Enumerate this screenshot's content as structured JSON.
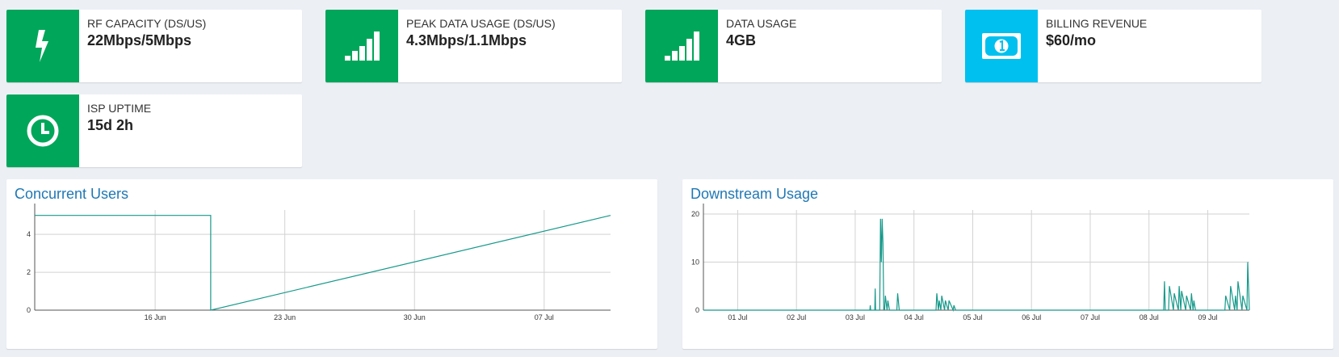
{
  "colors": {
    "green": "#00a65a",
    "aqua": "#00c0ef",
    "line": "#16998a",
    "title": "#1f78b4",
    "grid": "#d2d2d2"
  },
  "info_boxes": [
    {
      "label": "RF CAPACITY (DS/US)",
      "value": "22Mbps/5Mbps",
      "icon": "bolt-icon"
    },
    {
      "label": "PEAK DATA USAGE (DS/US)",
      "value": "4.3Mbps/1.1Mbps",
      "icon": "signal-bars-icon"
    },
    {
      "label": "DATA USAGE",
      "value": "4GB",
      "icon": "signal-bars-icon"
    },
    {
      "label": "BILLING REVENUE",
      "value": "$60/mo",
      "icon": "money-bill-icon"
    },
    {
      "label": "ISP UPTIME",
      "value": "15d 2h",
      "icon": "clock-icon"
    }
  ],
  "panels": {
    "concurrent": {
      "title": "Concurrent Users"
    },
    "downstream": {
      "title": "Downstream Usage"
    }
  },
  "chart_data": [
    {
      "type": "line",
      "title": "Concurrent Users",
      "xlabel": "",
      "ylabel": "",
      "x_ticks": [
        "16 Jun",
        "23 Jun",
        "30 Jun",
        "07 Jul"
      ],
      "x_range": [
        "2023-06-09T12:00",
        "2023-07-10T14:00"
      ],
      "ylim": [
        0,
        5.2
      ],
      "y_ticks": [
        0,
        2,
        4
      ],
      "grid": true,
      "series": [
        {
          "x": [
            "2023-06-09T12:00",
            "2023-06-19T00:00",
            "2023-06-19T00:00",
            "2023-07-10T14:00"
          ],
          "values": [
            5,
            5,
            0,
            5
          ]
        }
      ]
    },
    {
      "type": "line",
      "title": "Downstream Usage",
      "xlabel": "",
      "ylabel": "",
      "x_ticks": [
        "01 Jul",
        "02 Jul",
        "03 Jul",
        "04 Jul",
        "05 Jul",
        "06 Jul",
        "07 Jul",
        "08 Jul",
        "09 Jul"
      ],
      "x_range": [
        "2023-06-30T10:00",
        "2023-07-09T17:00"
      ],
      "ylim": [
        0,
        20.5
      ],
      "y_ticks": [
        0,
        10,
        20
      ],
      "grid": true,
      "series": [
        {
          "x": [
            "2023-06-30T10:00",
            "2023-07-03T06:00",
            "2023-07-03T06:10",
            "2023-07-03T06:20",
            "2023-07-03T08:00",
            "2023-07-03T08:10",
            "2023-07-03T08:20",
            "2023-07-03T10:00",
            "2023-07-03T10:20",
            "2023-07-03T10:40",
            "2023-07-03T11:00",
            "2023-07-03T11:20",
            "2023-07-03T11:40",
            "2023-07-03T12:00",
            "2023-07-03T12:20",
            "2023-07-03T13:00",
            "2023-07-03T13:20",
            "2023-07-03T14:00",
            "2023-07-03T14:20",
            "2023-07-03T17:00",
            "2023-07-03T17:20",
            "2023-07-03T18:00",
            "2023-07-04T09:00",
            "2023-07-04T09:20",
            "2023-07-04T10:00",
            "2023-07-04T10:20",
            "2023-07-04T11:00",
            "2023-07-04T11:20",
            "2023-07-04T12:30",
            "2023-07-04T12:50",
            "2023-07-04T14:00",
            "2023-07-04T14:20",
            "2023-07-04T16:00",
            "2023-07-04T16:20",
            "2023-07-04T17:00",
            "2023-07-08T06:00",
            "2023-07-08T06:20",
            "2023-07-08T06:40",
            "2023-07-08T08:00",
            "2023-07-08T08:20",
            "2023-07-08T10:00",
            "2023-07-08T10:20",
            "2023-07-08T12:00",
            "2023-07-08T12:20",
            "2023-07-08T13:00",
            "2023-07-08T13:20",
            "2023-07-08T15:00",
            "2023-07-08T15:20",
            "2023-07-08T17:00",
            "2023-07-08T17:20",
            "2023-07-08T18:00",
            "2023-07-08T18:20",
            "2023-07-08T19:00",
            "2023-07-09T07:00",
            "2023-07-09T07:20",
            "2023-07-09T09:00",
            "2023-07-09T09:20",
            "2023-07-09T11:00",
            "2023-07-09T11:20",
            "2023-07-09T12:00",
            "2023-07-09T12:20",
            "2023-07-09T14:00",
            "2023-07-09T14:20",
            "2023-07-09T16:00",
            "2023-07-09T16:20",
            "2023-07-09T17:00"
          ],
          "values": [
            0,
            0,
            1,
            0,
            0,
            4.5,
            0,
            0,
            19,
            10,
            19,
            14,
            0,
            0,
            3,
            0,
            2,
            0,
            0,
            0,
            3.5,
            0,
            0,
            3.5,
            0,
            2,
            0,
            3,
            0,
            2,
            0,
            2,
            0,
            1,
            0,
            0,
            6,
            0,
            0,
            5,
            0,
            3.5,
            0,
            5,
            0,
            4,
            0,
            3,
            0,
            3.5,
            0,
            2,
            0,
            0,
            3,
            0,
            5,
            0,
            3,
            0,
            6,
            0,
            3,
            0,
            10,
            0
          ]
        }
      ]
    }
  ]
}
